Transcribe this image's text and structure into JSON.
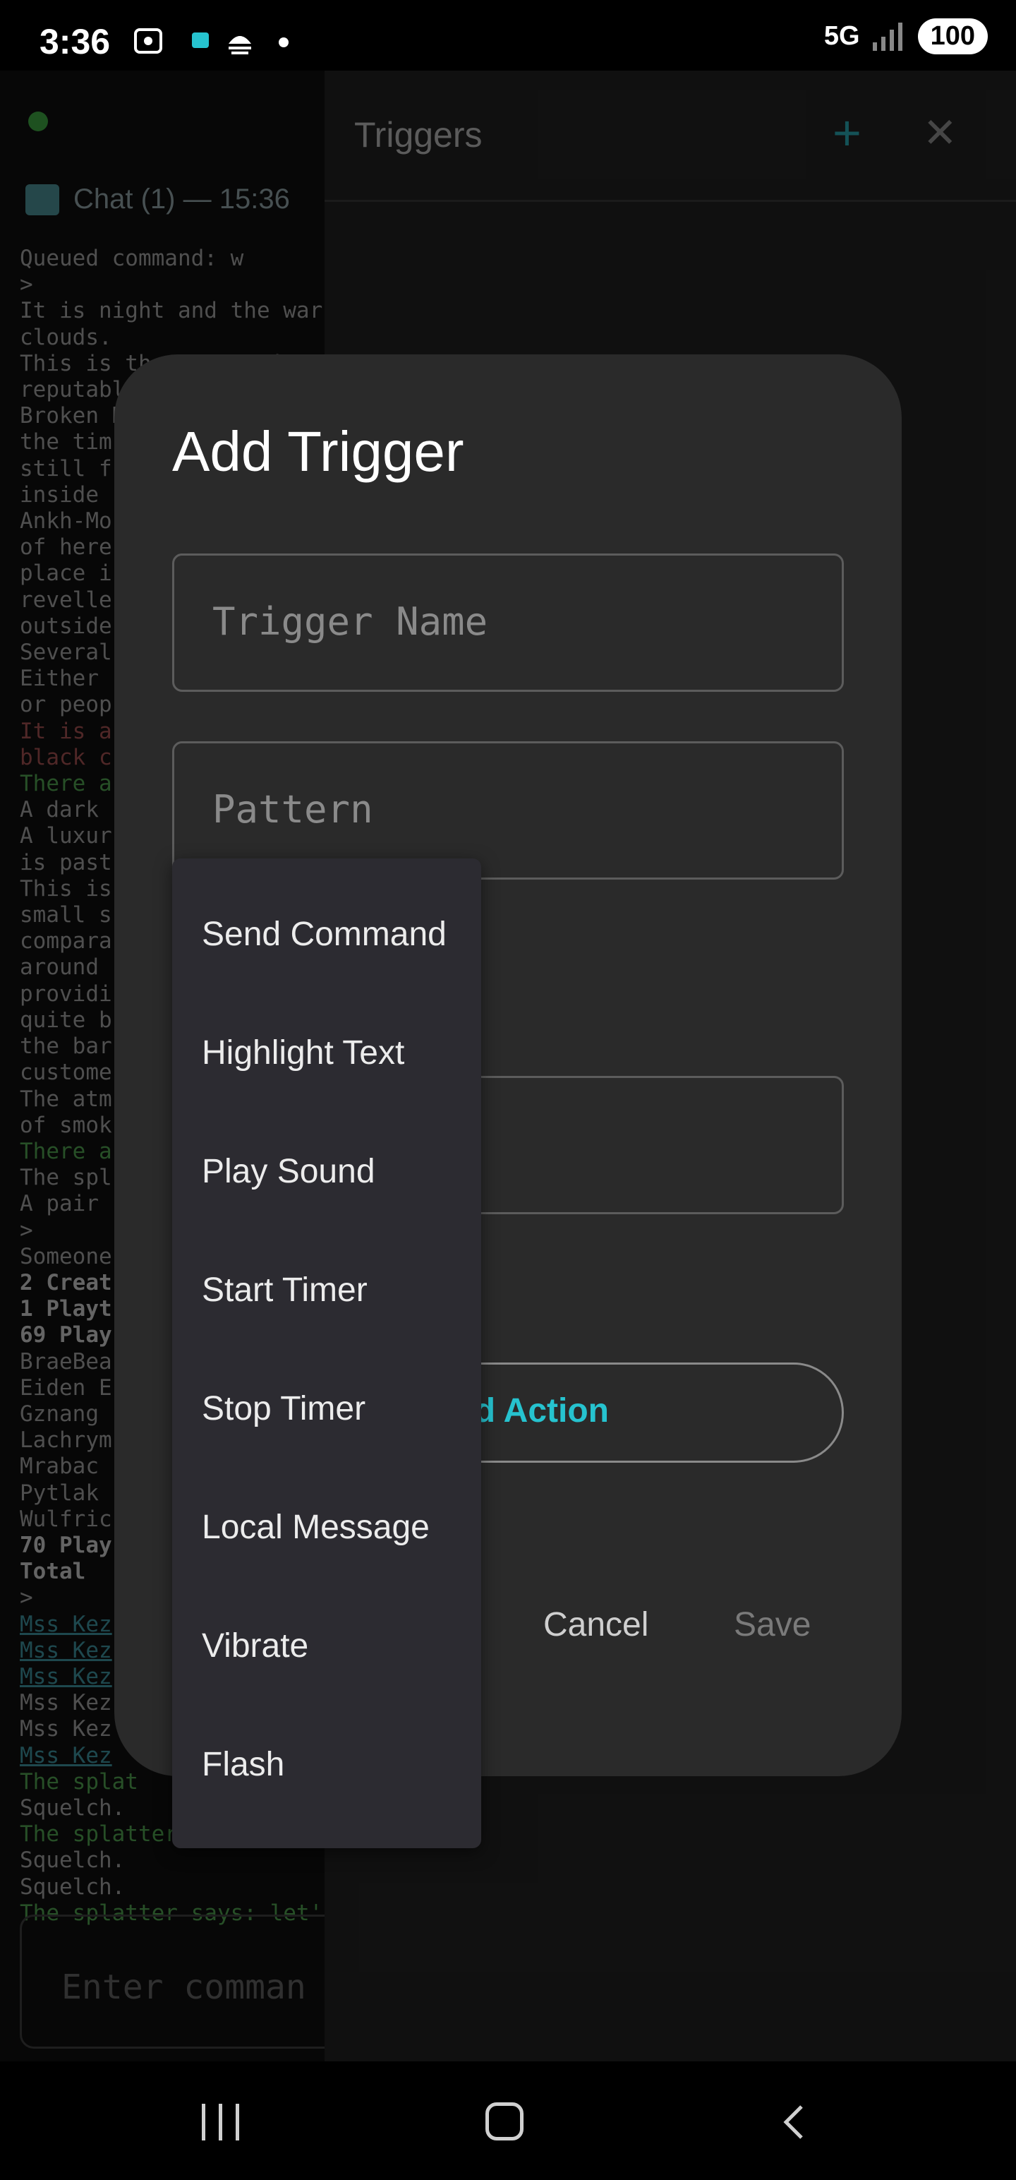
{
  "status_bar": {
    "time": "3:36",
    "network": "5G",
    "battery": "100"
  },
  "background_app": {
    "chat_tab": "Chat (1) — 15:36",
    "log_lines": [
      {
        "text": "Queued command: w",
        "cls": ""
      },
      {
        "text": ">",
        "cls": ""
      },
      {
        "text": "It is night and the war",
        "cls": ""
      },
      {
        "text": "clouds.",
        "cls": ""
      },
      {
        "text": "This is the street just",
        "cls": ""
      },
      {
        "text": "reputable",
        "cls": ""
      },
      {
        "text": "Broken D",
        "cls": ""
      },
      {
        "text": "the tim",
        "cls": ""
      },
      {
        "text": "still f",
        "cls": ""
      },
      {
        "text": "inside",
        "cls": ""
      },
      {
        "text": "Ankh-Mo",
        "cls": ""
      },
      {
        "text": "of here",
        "cls": ""
      },
      {
        "text": "place i",
        "cls": ""
      },
      {
        "text": "revelle",
        "cls": ""
      },
      {
        "text": "outside",
        "cls": ""
      },
      {
        "text": "Several",
        "cls": ""
      },
      {
        "text": "Either",
        "cls": ""
      },
      {
        "text": "or peop",
        "cls": ""
      },
      {
        "text": "It is a",
        "cls": "red"
      },
      {
        "text": "black c",
        "cls": "red"
      },
      {
        "text": "There a",
        "cls": "green"
      },
      {
        "text": "A dark",
        "cls": ""
      },
      {
        "text": "A luxur",
        "cls": ""
      },
      {
        "text": "is past",
        "cls": ""
      },
      {
        "text": "This is",
        "cls": ""
      },
      {
        "text": "small s",
        "cls": ""
      },
      {
        "text": "compara",
        "cls": ""
      },
      {
        "text": "around",
        "cls": ""
      },
      {
        "text": "providi",
        "cls": ""
      },
      {
        "text": "quite b",
        "cls": ""
      },
      {
        "text": "the bar",
        "cls": ""
      },
      {
        "text": "custome",
        "cls": ""
      },
      {
        "text": "The atm",
        "cls": ""
      },
      {
        "text": "of smok",
        "cls": ""
      },
      {
        "text": "There a",
        "cls": "green"
      },
      {
        "text": "The spl",
        "cls": ""
      },
      {
        "text": "A pair",
        "cls": ""
      },
      {
        "text": ">",
        "cls": ""
      },
      {
        "text": "Someone",
        "cls": ""
      },
      {
        "text": "2 Creat",
        "cls": "bold"
      },
      {
        "text": "1 Playt",
        "cls": "bold"
      },
      {
        "text": "69 Play",
        "cls": "bold"
      },
      {
        "text": "BraeBea",
        "cls": ""
      },
      {
        "text": "Eiden E",
        "cls": ""
      },
      {
        "text": "Gznang",
        "cls": ""
      },
      {
        "text": "Lachrym",
        "cls": ""
      },
      {
        "text": "Mrabac",
        "cls": ""
      },
      {
        "text": "Pytlak",
        "cls": ""
      },
      {
        "text": "Wulfric",
        "cls": ""
      },
      {
        "text": "70 Play",
        "cls": "bold"
      },
      {
        "text": "Total",
        "cls": "bold"
      },
      {
        "text": ">",
        "cls": ""
      },
      {
        "text": "Mss Kez",
        "cls": "link"
      },
      {
        "text": "Mss Kez",
        "cls": "link"
      },
      {
        "text": "Mss Kez",
        "cls": "link"
      },
      {
        "text": "Mss Kez",
        "cls": ""
      },
      {
        "text": "Mss Kez",
        "cls": ""
      },
      {
        "text": "Mss Kez",
        "cls": "link"
      },
      {
        "text": "The splat",
        "cls": "green"
      },
      {
        "text": "Squelch.",
        "cls": ""
      },
      {
        "text": "The splatter",
        "cls": "green"
      },
      {
        "text": "Squelch.",
        "cls": ""
      },
      {
        "text": "Squelch.",
        "cls": ""
      },
      {
        "text": "The splatter says: let'",
        "cls": "green"
      }
    ],
    "command_placeholder": "Enter comman"
  },
  "triggers_panel": {
    "title": "Triggers"
  },
  "dialog": {
    "title": "Add Trigger",
    "trigger_name_placeholder": "Trigger Name",
    "pattern_placeholder": "Pattern",
    "add_action_label": "d Action",
    "cancel_label": "Cancel",
    "save_label": "Save"
  },
  "dropdown": {
    "items": [
      "Send Command",
      "Highlight Text",
      "Play Sound",
      "Start Timer",
      "Stop Timer",
      "Local Message",
      "Vibrate",
      "Flash"
    ]
  },
  "colors": {
    "accent": "#26c3cf",
    "panel": "#1a1a1a",
    "dialog": "#2a2a2a",
    "menu": "#2c2b31"
  }
}
